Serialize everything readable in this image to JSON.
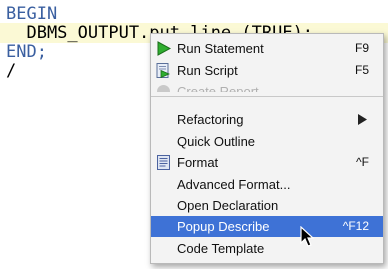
{
  "editor": {
    "lines": [
      "BEGIN",
      "  DBMS_OUTPUT.put_line (TRUE);",
      "END;",
      "/"
    ],
    "keyword_color": "#3a5fa0",
    "current_line_color": "#fbf9d5"
  },
  "context_menu": {
    "items": [
      {
        "label": "Run Statement",
        "shortcut": "F9",
        "icon": "run-statement-icon"
      },
      {
        "label": "Run Script",
        "shortcut": "F5",
        "icon": "run-script-icon"
      },
      {
        "label": "Create Report",
        "shortcut": "",
        "icon": "report-icon",
        "disabled": true
      },
      {
        "label": "Refactoring",
        "shortcut": "",
        "submenu": true
      },
      {
        "label": "Quick Outline",
        "shortcut": ""
      },
      {
        "label": "Format",
        "shortcut": "^F",
        "icon": "format-icon"
      },
      {
        "label": "Advanced Format...",
        "shortcut": ""
      },
      {
        "label": "Open Declaration",
        "shortcut": ""
      },
      {
        "label": "Popup Describe",
        "shortcut": "^F12",
        "selected": true
      },
      {
        "label": "Code Template",
        "shortcut": ""
      }
    ],
    "selection_color": "#3e72d6"
  }
}
